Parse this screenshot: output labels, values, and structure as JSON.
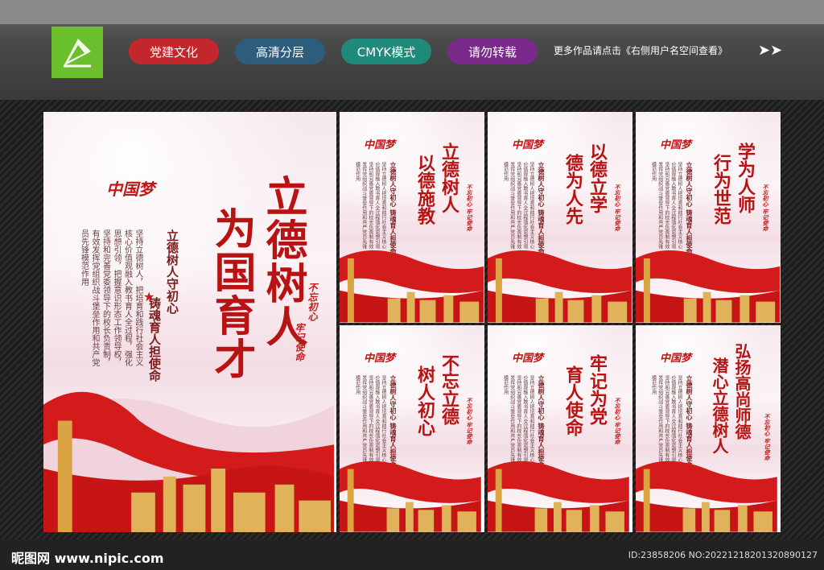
{
  "header": {
    "tags": [
      {
        "label": "党建文化",
        "color": "#c4262e"
      },
      {
        "label": "高清分层",
        "color": "#2d5d7b"
      },
      {
        "label": "CMYK模式",
        "color": "#1f8a7a"
      },
      {
        "label": "请勿转载",
        "color": "#7a2a8a"
      }
    ],
    "note": "更多作品请点击《右侧用户名空间查看》",
    "arrows": "➤➤"
  },
  "main_poster": {
    "title_line1": "立德树人",
    "title_line2": "为国育才",
    "sub1": "立德树人守初心",
    "sub2": "铸魂育人担使命",
    "seal1": "不忘初心",
    "seal2": "牢记使命",
    "body": "坚持立德树人，把培育和践行社会主义核心价值观融入教书育人全过程，强化思想引领，把握意识形态工作领导权，坚持和完善党委领导下的校长负责制，有效发挥党组织战斗堡垒作用和共产党员先锋模范作用",
    "dream": "中国梦"
  },
  "posters": [
    {
      "l1": "立德树人",
      "l2": "以德施教"
    },
    {
      "l1": "以德立学",
      "l2": "德为人先"
    },
    {
      "l1": "学为人师",
      "l2": "行为世范"
    },
    {
      "l1": "不忘立德",
      "l2": "树人初心"
    },
    {
      "l1": "牢记为党",
      "l2": "育人使命"
    },
    {
      "l1": "弘扬高尚师德",
      "l2": "潜心立德树人"
    }
  ],
  "poster_common": {
    "sub": "立德树人守初心  铸魂育人担使命",
    "seal": "不忘初心 牢记使命",
    "body": "坚持立德树人把培育和践行社会主义核心价值观融入教书育人全过程强化思想引领坚持和完善党委领导下的校长负责制有效发挥党组织战斗堡垒作用和共产党员先锋模范作用",
    "dream": "中国梦"
  },
  "footer": {
    "watermark": "昵图网 www.nipic.com",
    "id": "ID:23858206 NO:20221218201320890127"
  }
}
